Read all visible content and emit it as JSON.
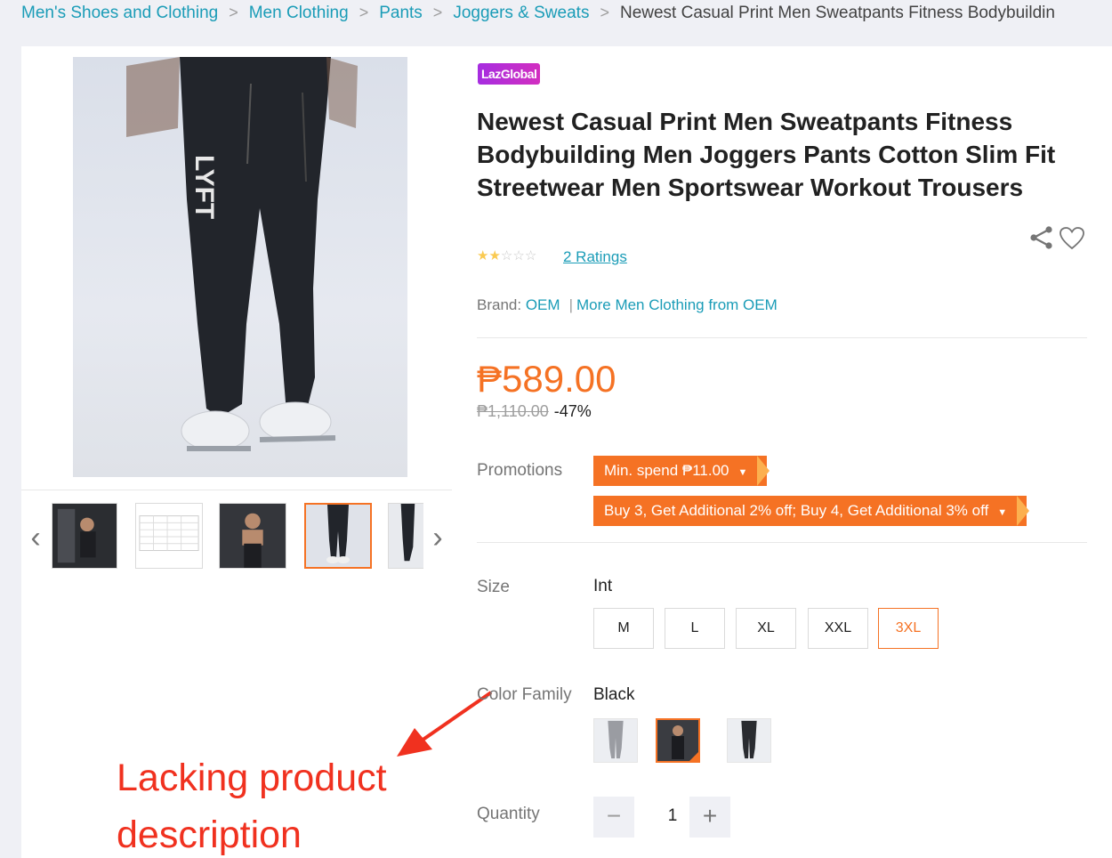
{
  "breadcrumb": {
    "items": [
      "Men's Shoes and Clothing",
      "Men Clothing",
      "Pants",
      "Joggers & Sweats"
    ],
    "current": "Newest Casual Print Men Sweatpants Fitness Bodybuildin",
    "separator": ">"
  },
  "gallery": {
    "prev_glyph": "‹",
    "next_glyph": "›",
    "main_image_text": "LYFT",
    "selected_thumb_index": 3
  },
  "product": {
    "badge": "LazGlobal",
    "title": "Newest Casual Print Men Sweatpants Fitness Bodybuilding Men Joggers Pants Cotton Slim Fit Streetwear Men Sportswear Workout Trousers",
    "rating_stars": 2,
    "rating_max": 5,
    "ratings_label": "2 Ratings",
    "brand_label": "Brand:",
    "brand_name": "OEM",
    "brand_more": "More Men Clothing from OEM",
    "price": "₱589.00",
    "old_price": "₱1,110.00",
    "discount": "-47%"
  },
  "promotions": {
    "label": "Promotions",
    "items": [
      "Min. spend ₱11.00",
      "Buy 3, Get Additional 2% off; Buy 4, Get Additional 3% off"
    ],
    "caret": "▼"
  },
  "size": {
    "label": "Size",
    "system": "Int",
    "options": [
      "M",
      "L",
      "XL",
      "XXL",
      "3XL"
    ],
    "selected": "3XL"
  },
  "color": {
    "label": "Color Family",
    "value": "Black",
    "selected_index": 1
  },
  "quantity": {
    "label": "Quantity",
    "value": "1",
    "minus": "−",
    "plus": "+"
  },
  "annotation": {
    "line1": "Lacking product",
    "line2": "description"
  },
  "colors": {
    "accent": "#f57224",
    "link": "#1a9cb7",
    "annotation": "#f0311f",
    "star": "#faca51"
  }
}
